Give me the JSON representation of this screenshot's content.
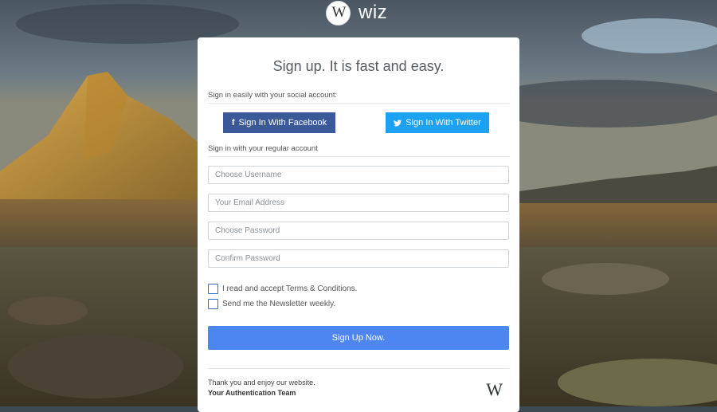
{
  "brand": {
    "logo_letter": "W",
    "name": "wiz"
  },
  "form": {
    "title": "Sign up. It is fast and easy.",
    "social_label": "Sign in easily with your social account:",
    "facebook": {
      "icon": "f",
      "label": "Sign In With Facebook",
      "color": "#3b5998"
    },
    "twitter": {
      "icon": "twitter-bird",
      "label": "Sign In With Twitter",
      "color": "#1da1f2"
    },
    "regular_label": "Sign in with your regular account",
    "username_placeholder": "Choose Username",
    "email_placeholder": "Your Email Address",
    "password_placeholder": "Choose Password",
    "confirm_placeholder": "Confirm Password",
    "terms_label": "I read and accept Terms & Conditions.",
    "newsletter_label": "Send me the Newsletter weekly.",
    "submit_label": "Sign Up Now.",
    "submit_color": "#4d86f0"
  },
  "footer": {
    "thanks": "Thank you and enjoy our website.",
    "team": "Your Authentication Team",
    "logo_letter": "W"
  }
}
